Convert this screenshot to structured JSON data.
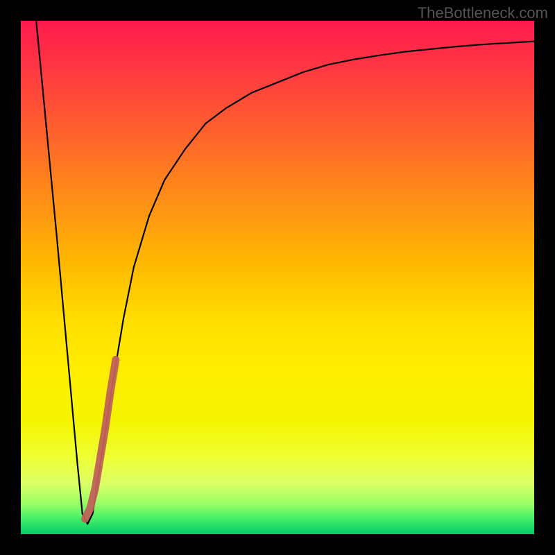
{
  "watermark": "TheBottleneck.com",
  "chart_data": {
    "type": "line",
    "title": "",
    "xlabel": "",
    "ylabel": "",
    "xlim": [
      0,
      100
    ],
    "ylim": [
      0,
      100
    ],
    "grid": false,
    "series": [
      {
        "name": "main-curve",
        "color": "#000000",
        "x": [
          3,
          5,
          7,
          9,
          11,
          12,
          13,
          14,
          16,
          18,
          20,
          22,
          25,
          28,
          32,
          36,
          40,
          45,
          50,
          55,
          60,
          65,
          70,
          75,
          80,
          85,
          90,
          95,
          100
        ],
        "values": [
          100,
          79,
          58,
          36,
          14,
          4,
          2,
          4,
          17,
          30,
          42,
          52,
          62,
          69,
          75,
          80,
          83,
          86,
          88,
          90,
          91.5,
          92.5,
          93.3,
          94,
          94.5,
          95,
          95.4,
          95.7,
          96
        ]
      },
      {
        "name": "highlight-segment",
        "color": "#bb5555",
        "x": [
          12.5,
          13.5,
          14.5,
          15.5,
          16.5,
          17.5,
          18.5
        ],
        "values": [
          3,
          5,
          9,
          15,
          21,
          28,
          34
        ]
      }
    ],
    "gradient_background": {
      "top": "red",
      "middle": "yellow",
      "bottom": "green"
    }
  }
}
